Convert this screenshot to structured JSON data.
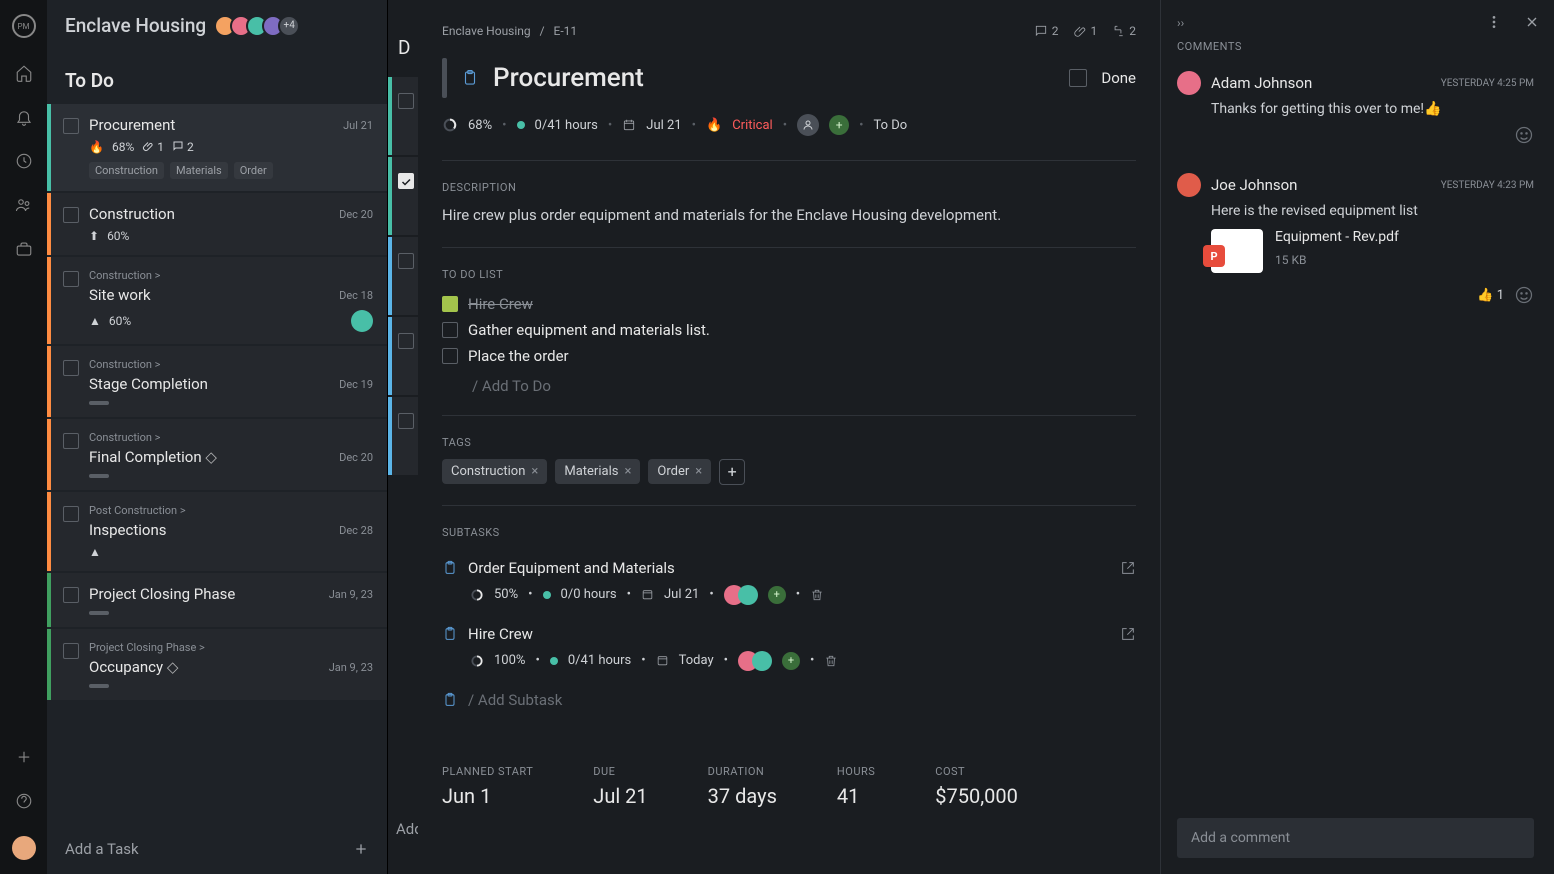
{
  "project": {
    "name": "Enclave Housing",
    "extra_avatars": "+4"
  },
  "columns": {
    "todo": {
      "title": "To Do"
    },
    "peek": {
      "title": "D",
      "foot": "Add"
    }
  },
  "tasks": [
    {
      "name": "Procurement",
      "date": "Jul 21",
      "stripe": "#48bfa7",
      "selected": true,
      "meta": {
        "priority": "🔥",
        "pct": "68%",
        "attach": "1",
        "comments": "2"
      },
      "tags": [
        "Construction",
        "Materials",
        "Order"
      ]
    },
    {
      "name": "Construction",
      "date": "Dec 20",
      "stripe": "#ff8c42",
      "meta": {
        "priority": "⬆",
        "pct": "60%"
      }
    },
    {
      "crumb": "Construction >",
      "name": "Site work",
      "date": "Dec 18",
      "stripe": "#ff8c42",
      "meta": {
        "priority": "▲",
        "pct": "60%"
      },
      "avatar": "#48bfa7"
    },
    {
      "crumb": "Construction >",
      "name": "Stage Completion",
      "date": "Dec 19",
      "stripe": "#ff8c42",
      "bar": true,
      "avatar": "#e05c4a"
    },
    {
      "crumb": "Construction >",
      "name": "Final Completion",
      "milestone": true,
      "date": "Dec 20",
      "stripe": "#ff8c42",
      "bar": true
    },
    {
      "crumb": "Post Construction >",
      "name": "Inspections",
      "date": "Dec 28",
      "stripe": "#ff8c42",
      "meta": {
        "priority": "▲"
      }
    },
    {
      "name": "Project Closing Phase",
      "date": "Jan 9, 23",
      "stripe": "#40a060",
      "bar": true
    },
    {
      "crumb": "Project Closing Phase >",
      "name": "Occupancy",
      "milestone": true,
      "date": "Jan 9, 23",
      "stripe": "#40a060",
      "bar": true
    }
  ],
  "add_task_label": "Add a Task",
  "peek_cards": [
    {
      "stripe": "#48bfa7",
      "done": false
    },
    {
      "stripe": "#48bfa7",
      "done": true
    },
    {
      "stripe": "#5bb5e8",
      "done": false
    },
    {
      "stripe": "#5bb5e8",
      "done": false
    },
    {
      "stripe": "#5bb5e8",
      "done": false
    }
  ],
  "detail": {
    "crumb_project": "Enclave Housing",
    "crumb_sep": "/",
    "crumb_id": "E-11",
    "stats": {
      "comments": "2",
      "attach": "1",
      "subtasks": "2"
    },
    "title": "Procurement",
    "done_label": "Done",
    "meta": {
      "pct": "68%",
      "hours": "0/41 hours",
      "date": "Jul 21",
      "priority": "Critical",
      "status": "To Do"
    },
    "description_label": "DESCRIPTION",
    "description": "Hire crew plus order equipment and materials for the Enclave Housing development.",
    "todo_label": "TO DO LIST",
    "todos": [
      {
        "label": "Hire Crew",
        "done": true
      },
      {
        "label": "Gather equipment and materials list.",
        "done": false
      },
      {
        "label": "Place the order",
        "done": false
      }
    ],
    "add_todo": "/ Add To Do",
    "tags_label": "TAGS",
    "tags": [
      "Construction",
      "Materials",
      "Order"
    ],
    "subtasks_label": "SUBTASKS",
    "subtasks": [
      {
        "name": "Order Equipment and Materials",
        "pct": "50%",
        "hours": "0/0 hours",
        "date": "Jul 21"
      },
      {
        "name": "Hire Crew",
        "pct": "100%",
        "hours": "0/41 hours",
        "date": "Today"
      }
    ],
    "add_subtask": "/ Add Subtask",
    "grid": {
      "planned_start": {
        "label": "PLANNED START",
        "val": "Jun 1"
      },
      "due": {
        "label": "DUE",
        "val": "Jul 21"
      },
      "duration": {
        "label": "DURATION",
        "val": "37 days"
      },
      "hours": {
        "label": "HOURS",
        "val": "41"
      },
      "cost": {
        "label": "COST",
        "val": "$750,000"
      }
    }
  },
  "comments_panel": {
    "title": "COMMENTS",
    "items": [
      {
        "author": "Adam Johnson",
        "time": "YESTERDAY 4:25 PM",
        "body": "Thanks for getting this over to me!👍",
        "avatar": "#e76f88"
      },
      {
        "author": "Joe Johnson",
        "time": "YESTERDAY 4:23 PM",
        "body": "Here is the revised equipment list",
        "avatar": "#e05c4a",
        "attachment": {
          "name": "Equipment - Rev.pdf",
          "size": "15 KB",
          "badge": "P"
        },
        "reaction": {
          "emoji": "👍",
          "count": "1"
        }
      }
    ],
    "add_placeholder": "Add a comment"
  }
}
